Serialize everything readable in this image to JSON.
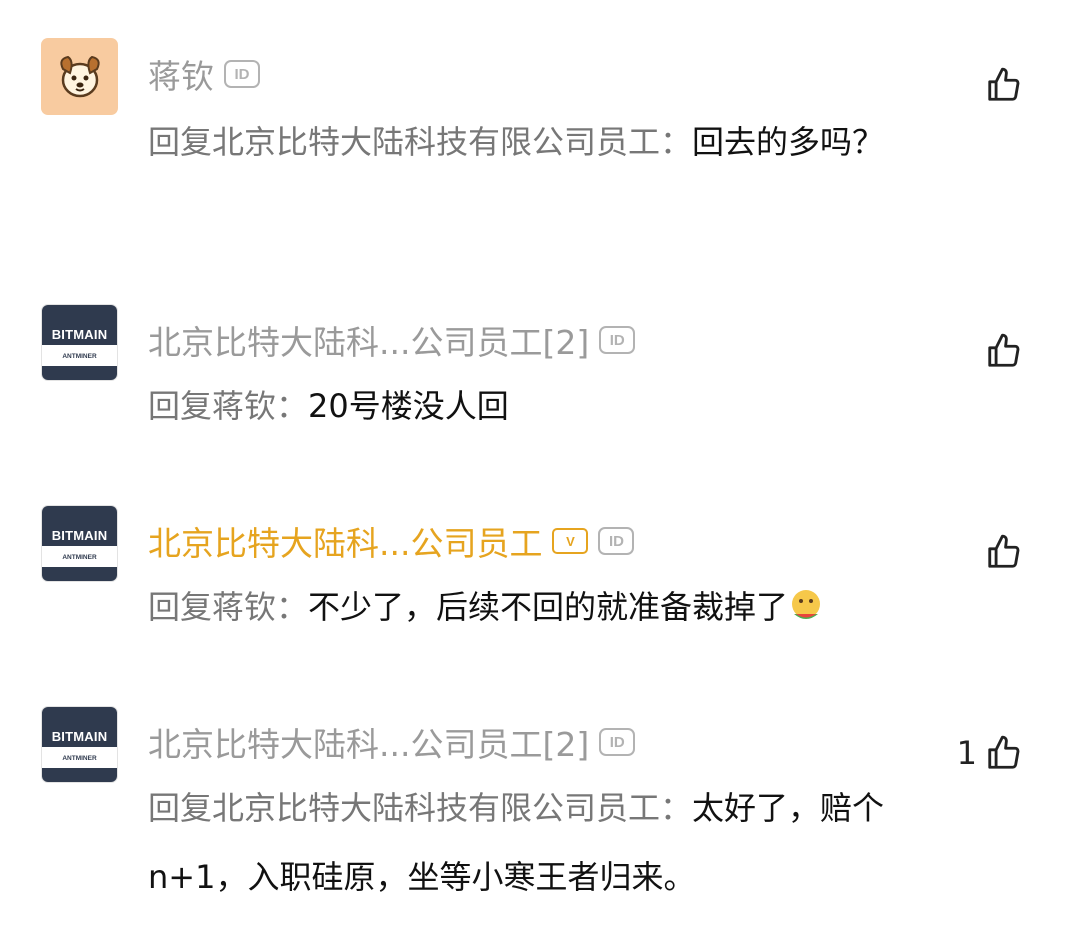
{
  "comments": [
    {
      "avatar": "dog-avatar",
      "name": "蒋钦",
      "name_color": "#9a9a9a",
      "badges": [
        "ID"
      ],
      "reply_prefix": "回复北京比特大陆科技有限公司员工：",
      "text": "回去的多吗？",
      "likes": ""
    },
    {
      "avatar": "bitmain-avatar",
      "name": "北京比特大陆科...公司员工[2]",
      "name_color": "#9a9a9a",
      "badges": [
        "ID"
      ],
      "reply_prefix": "回复蒋钦：",
      "text": "20号楼没人回",
      "likes": ""
    },
    {
      "avatar": "bitmain-avatar",
      "name": "北京比特大陆科...公司员工",
      "name_color": "#e6a41f",
      "badges": [
        "V",
        "ID"
      ],
      "reply_prefix": "回复蒋钦：",
      "text": "不少了，后续不回的就准备裁掉了",
      "emoji": "eating-watermelon-emoji",
      "likes": ""
    },
    {
      "avatar": "bitmain-avatar",
      "name": "北京比特大陆科...公司员工[2]",
      "name_color": "#9a9a9a",
      "badges": [
        "ID"
      ],
      "reply_prefix": "回复北京比特大陆科技有限公司员工：",
      "text": "太好了，赔个n+1，入职硅原，坐等小寒王者归来。",
      "likes": "1"
    }
  ],
  "avatar_text": {
    "brand": "BITMAIN",
    "sub": "ANTMINER"
  },
  "icons": {
    "id_badge": "ID",
    "like": "thumbs-up-icon"
  }
}
